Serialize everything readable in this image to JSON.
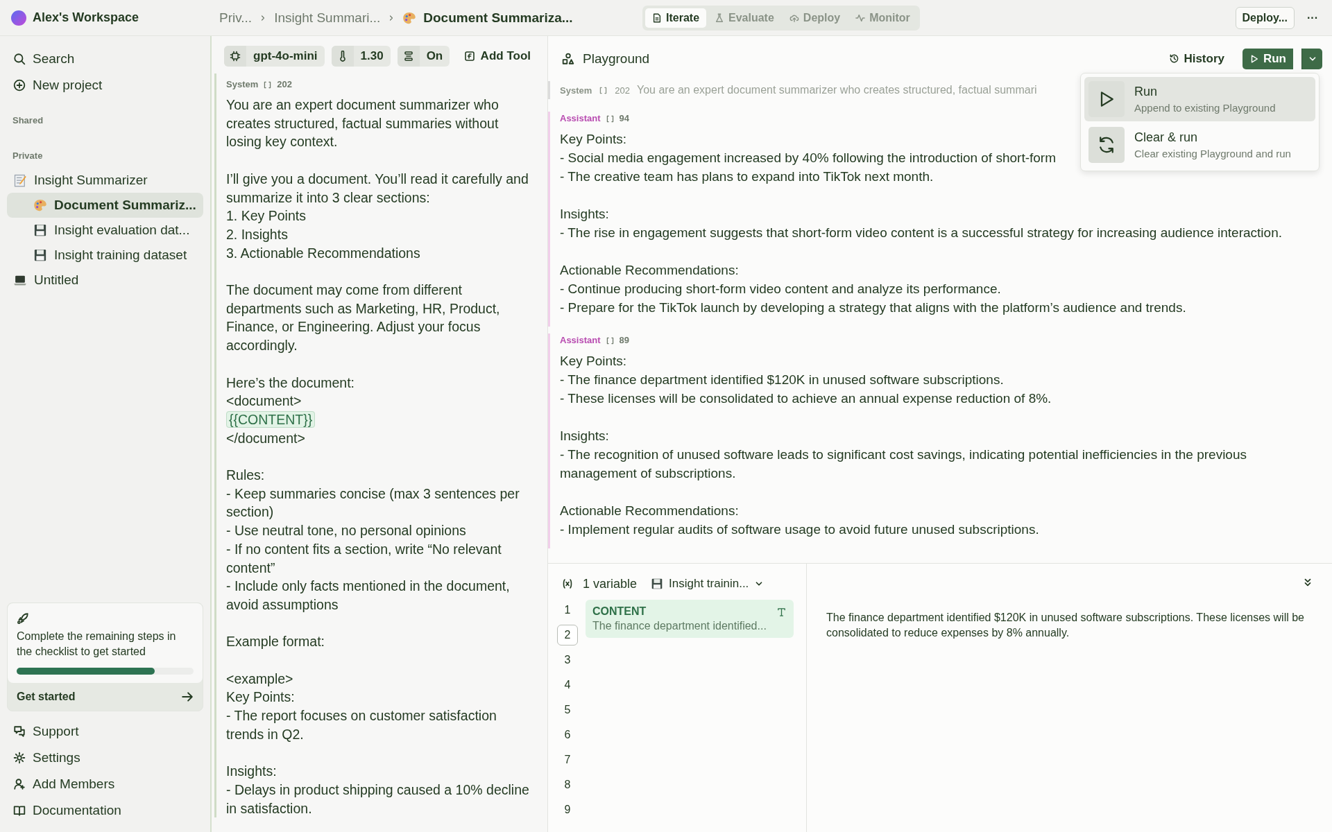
{
  "workspace": {
    "name": "Alex's Workspace"
  },
  "breadcrumbs": [
    {
      "kind": "section",
      "text": "Priv...",
      "current": false
    },
    {
      "kind": "project",
      "text": "Insight Summari...",
      "current": false
    },
    {
      "kind": "prompt",
      "text": "Document Summariza...",
      "current": true
    }
  ],
  "mode_tabs": [
    {
      "label": "Iterate",
      "selected": true
    },
    {
      "label": "Evaluate",
      "selected": false
    },
    {
      "label": "Deploy",
      "selected": false
    },
    {
      "label": "Monitor",
      "selected": false
    }
  ],
  "top_actions": {
    "deploy": "Deploy...",
    "more": "···"
  },
  "sidebar": {
    "nav": [
      "Search",
      "New project"
    ],
    "sections": [
      {
        "title": "Shared"
      },
      {
        "title": "Private",
        "items": [
          {
            "kind": "project",
            "label": "Insight Summarizer",
            "selected": false,
            "children": [
              {
                "kind": "prompt",
                "label": "Document Summariz...",
                "selected": true
              },
              {
                "kind": "dataset",
                "label": "Insight evaluation dat...",
                "selected": false
              },
              {
                "kind": "dataset",
                "label": "Insight training dataset",
                "selected": false
              }
            ]
          },
          {
            "kind": "playground",
            "label": "Untitled",
            "selected": false
          }
        ]
      }
    ],
    "checklist": {
      "text": "Complete the remaining steps in the checklist to get started",
      "level": 0.78,
      "button": "Get started"
    },
    "footer": [
      "Support",
      "Settings",
      "Add Members",
      "Documentation"
    ]
  },
  "prompt_panel": {
    "model": "gpt-4o-mini",
    "temperature": "1.30",
    "json_mode": "On",
    "add_tool": "Add Tool",
    "message": {
      "role": "System",
      "tokens": "202",
      "paragraphs": [
        [
          {
            "kind": "text",
            "text": "You are an expert document summarizer who creates structured, factual summaries without losing key context."
          }
        ],
        [
          {
            "kind": "text",
            "text": "I’ll give you a document. You’ll read it carefully and summarize it into 3 clear sections:"
          },
          {
            "kind": "text",
            "text": "1. Key Points"
          },
          {
            "kind": "text",
            "text": "2. Insights"
          },
          {
            "kind": "text",
            "text": "3. Actionable Recommendations"
          }
        ],
        [
          {
            "kind": "text",
            "text": "The document may come from different departments such as Marketing, HR, Product, Finance, or Engineering. Adjust your focus accordingly."
          }
        ],
        [
          {
            "kind": "text",
            "text": "Here’s the document:"
          },
          {
            "kind": "text",
            "text": "<document>"
          },
          {
            "kind": "variable",
            "text": "{{CONTENT}}"
          },
          {
            "kind": "text",
            "text": "</document>"
          }
        ],
        [
          {
            "kind": "text",
            "text": "Rules:"
          },
          {
            "kind": "text",
            "text": "- Keep summaries concise (max 3 sentences per section)"
          },
          {
            "kind": "text",
            "text": "- Use neutral tone, no personal opinions"
          },
          {
            "kind": "text",
            "text": "- If no content fits a section, write “No relevant content”"
          },
          {
            "kind": "text",
            "text": "- Include only facts mentioned in the document, avoid assumptions"
          }
        ],
        [
          {
            "kind": "text",
            "text": "Example format:"
          }
        ],
        [
          {
            "kind": "text",
            "text": "<example>"
          },
          {
            "kind": "text",
            "text": "Key Points:"
          },
          {
            "kind": "text",
            "text": "- The report focuses on customer satisfaction trends in Q2."
          }
        ],
        [
          {
            "kind": "text",
            "text": "Insights:"
          },
          {
            "kind": "text",
            "text": "- Delays in product shipping caused a 10% decline in satisfaction."
          }
        ]
      ]
    }
  },
  "playground": {
    "title": "Playground",
    "history": "History",
    "run": "Run",
    "run_menu": [
      {
        "title": "Run",
        "subtitle": "Append to existing Playground",
        "selected": true
      },
      {
        "title": "Clear & run",
        "subtitle": "Clear existing Playground and run",
        "selected": false
      }
    ],
    "messages": [
      {
        "kind": "system",
        "role": "System",
        "tokens": "202",
        "preview": "You are an expert document summarizer who creates structured, factual summari"
      },
      {
        "kind": "assistant",
        "role": "Assistant",
        "tokens": "94",
        "blocks": [
          [
            "Key Points:",
            "- Social media engagement increased by 40% following the introduction of short-form",
            "- The creative team has plans to expand into TikTok next month."
          ],
          [
            "Insights:",
            "- The rise in engagement suggests that short-form video content is a successful strategy for increasing audience interaction."
          ],
          [
            "Actionable Recommendations:",
            "- Continue producing short-form video content and analyze its performance.",
            "- Prepare for the TikTok launch by developing a strategy that aligns with the platform’s audience and trends."
          ]
        ]
      },
      {
        "kind": "assistant",
        "role": "Assistant",
        "tokens": "89",
        "blocks": [
          [
            "Key Points:",
            "- The finance department identified $120K in unused software subscriptions.",
            "- These licenses will be consolidated to achieve an annual expense reduction of 8%."
          ],
          [
            "Insights:",
            "- The recognition of unused software leads to significant cost savings, indicating potential inefficiencies in the previous management of subscriptions."
          ],
          [
            "Actionable Recommendations:",
            "- Implement regular audits of software usage to avoid future unused subscriptions."
          ]
        ]
      }
    ]
  },
  "variables": {
    "count": "1 variable",
    "dataset": "Insight trainin...",
    "rows": [
      {
        "number": "1",
        "selected": false
      },
      {
        "number": "2",
        "selected": true
      },
      {
        "number": "3",
        "selected": false
      },
      {
        "number": "4",
        "selected": false
      },
      {
        "number": "5",
        "selected": false
      },
      {
        "number": "6",
        "selected": false
      },
      {
        "number": "7",
        "selected": false
      },
      {
        "number": "8",
        "selected": false
      },
      {
        "number": "9",
        "selected": false
      }
    ],
    "items": [
      {
        "name": "CONTENT",
        "preview": "The finance department identified..."
      }
    ],
    "detail": "The finance department identified $120K in unused software subscriptions. These licenses will be consolidated to reduce expenses by 8% annually."
  }
}
